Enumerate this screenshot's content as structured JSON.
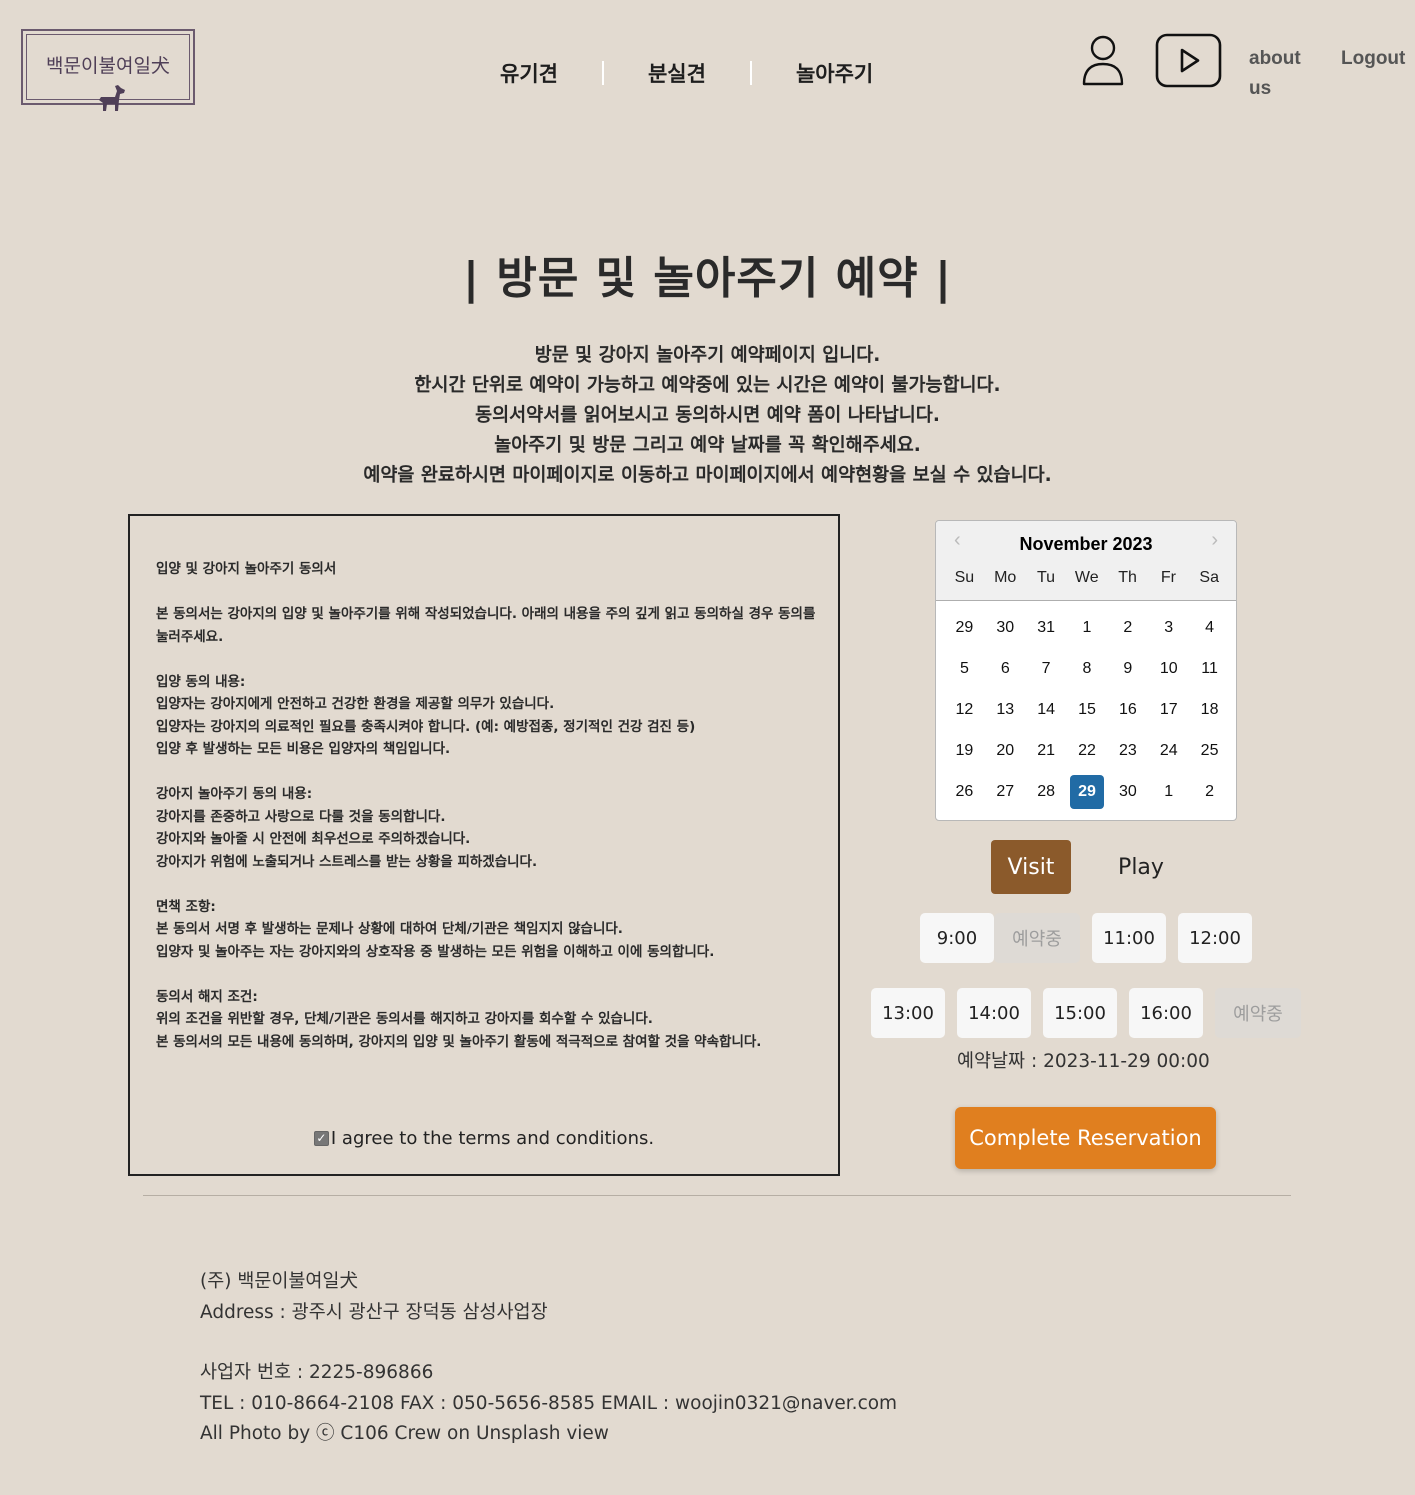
{
  "logo": {
    "text": "백문이불여일犬"
  },
  "nav": [
    {
      "label": "유기견"
    },
    {
      "label": "분실견"
    },
    {
      "label": "놀아주기"
    }
  ],
  "header": {
    "about_label": "about us",
    "logout_label": "Logout"
  },
  "page_title": "| 방문 및 놀아주기 예약 |",
  "intro_lines": [
    "방문 및 강아지 놀아주기 예약페이지 입니다.",
    "한시간 단위로 예약이 가능하고 예약중에 있는 시간은 예약이 불가능합니다.",
    "동의서약서를 읽어보시고 동의하시면 예약 폼이 나타납니다.",
    "놀아주기 및 방문 그리고 예약 날짜를 꼭 확인해주세요.",
    "예약을 완료하시면 마이페이지로 이동하고 마이페이지에서 예약현황을 보실 수 있습니다."
  ],
  "consent": {
    "text": "입양 및 강아지 놀아주기 동의서\n\n본 동의서는 강아지의 입양 및 놀아주기를 위해 작성되었습니다. 아래의 내용을 주의 깊게 읽고 동의하실 경우 동의를 눌러주세요.\n\n입양 동의 내용:\n입양자는 강아지에게 안전하고 건강한 환경을 제공할 의무가 있습니다.\n입양자는 강아지의 의료적인 필요를 충족시켜야 합니다. (예: 예방접종, 정기적인 건강 검진 등)\n입양 후 발생하는 모든 비용은 입양자의 책임입니다.\n\n강아지 놀아주기 동의 내용:\n강아지를 존중하고 사랑으로 다룰 것을 동의합니다.\n강아지와 놀아줄 시 안전에 최우선으로 주의하겠습니다.\n강아지가 위험에 노출되거나 스트레스를 받는 상황을 피하겠습니다.\n\n면책 조항:\n본 동의서 서명 후 발생하는 문제나 상황에 대하여 단체/기관은 책임지지 않습니다.\n입양자 및 놀아주는 자는 강아지와의 상호작용 중 발생하는 모든 위험을 이해하고 이에 동의합니다.\n\n동의서 해지 조건:\n위의 조건을 위반할 경우, 단체/기관은 동의서를 해지하고 강아지를 회수할 수 있습니다.\n본 동의서의 모든 내용에 동의하며, 강아지의 입양 및 놀아주기 활동에 적극적으로 참여할 것을 약속합니다.",
    "agree_label": "I agree to the terms and conditions.",
    "agreed": true
  },
  "calendar": {
    "month_label": "November 2023",
    "weekdays": [
      "Su",
      "Mo",
      "Tu",
      "We",
      "Th",
      "Fr",
      "Sa"
    ],
    "days": [
      "29",
      "30",
      "31",
      "1",
      "2",
      "3",
      "4",
      "5",
      "6",
      "7",
      "8",
      "9",
      "10",
      "11",
      "12",
      "13",
      "14",
      "15",
      "16",
      "17",
      "18",
      "19",
      "20",
      "21",
      "22",
      "23",
      "24",
      "25",
      "26",
      "27",
      "28",
      "29",
      "30",
      "1",
      "2"
    ],
    "selected_index": 31
  },
  "mode": {
    "visit_label": "Visit",
    "play_label": "Play",
    "selected": "Visit"
  },
  "slots_row1": [
    {
      "label": "9:00",
      "booked": false
    },
    {
      "label": "예약중",
      "booked": true
    },
    {
      "label": "11:00",
      "booked": false
    },
    {
      "label": "12:00",
      "booked": false
    }
  ],
  "slots_row2": [
    {
      "label": "13:00",
      "booked": false
    },
    {
      "label": "14:00",
      "booked": false
    },
    {
      "label": "15:00",
      "booked": false
    },
    {
      "label": "16:00",
      "booked": false
    },
    {
      "label": "예약중",
      "booked": true
    }
  ],
  "reservation_date": "예약날짜 : 2023-11-29 00:00",
  "complete_label": "Complete Reservation",
  "footer": {
    "company": "(주) 백문이불여일犬",
    "address": "Address : 광주시 광산구 장덕동 삼성사업장",
    "business_no": "사업자 번호 : 2225-896866",
    "contact": "TEL : 010-8664-2108 FAX : 050-5656-8585 EMAIL : woojin0321@naver.com",
    "credit": "All Photo by ⓒ C106 Crew on Unsplash view"
  },
  "colors": {
    "background": "#e2dad0",
    "visit_active": "#8b5a2b",
    "complete_button": "#e07f1f",
    "calendar_selected": "#216ba5"
  }
}
